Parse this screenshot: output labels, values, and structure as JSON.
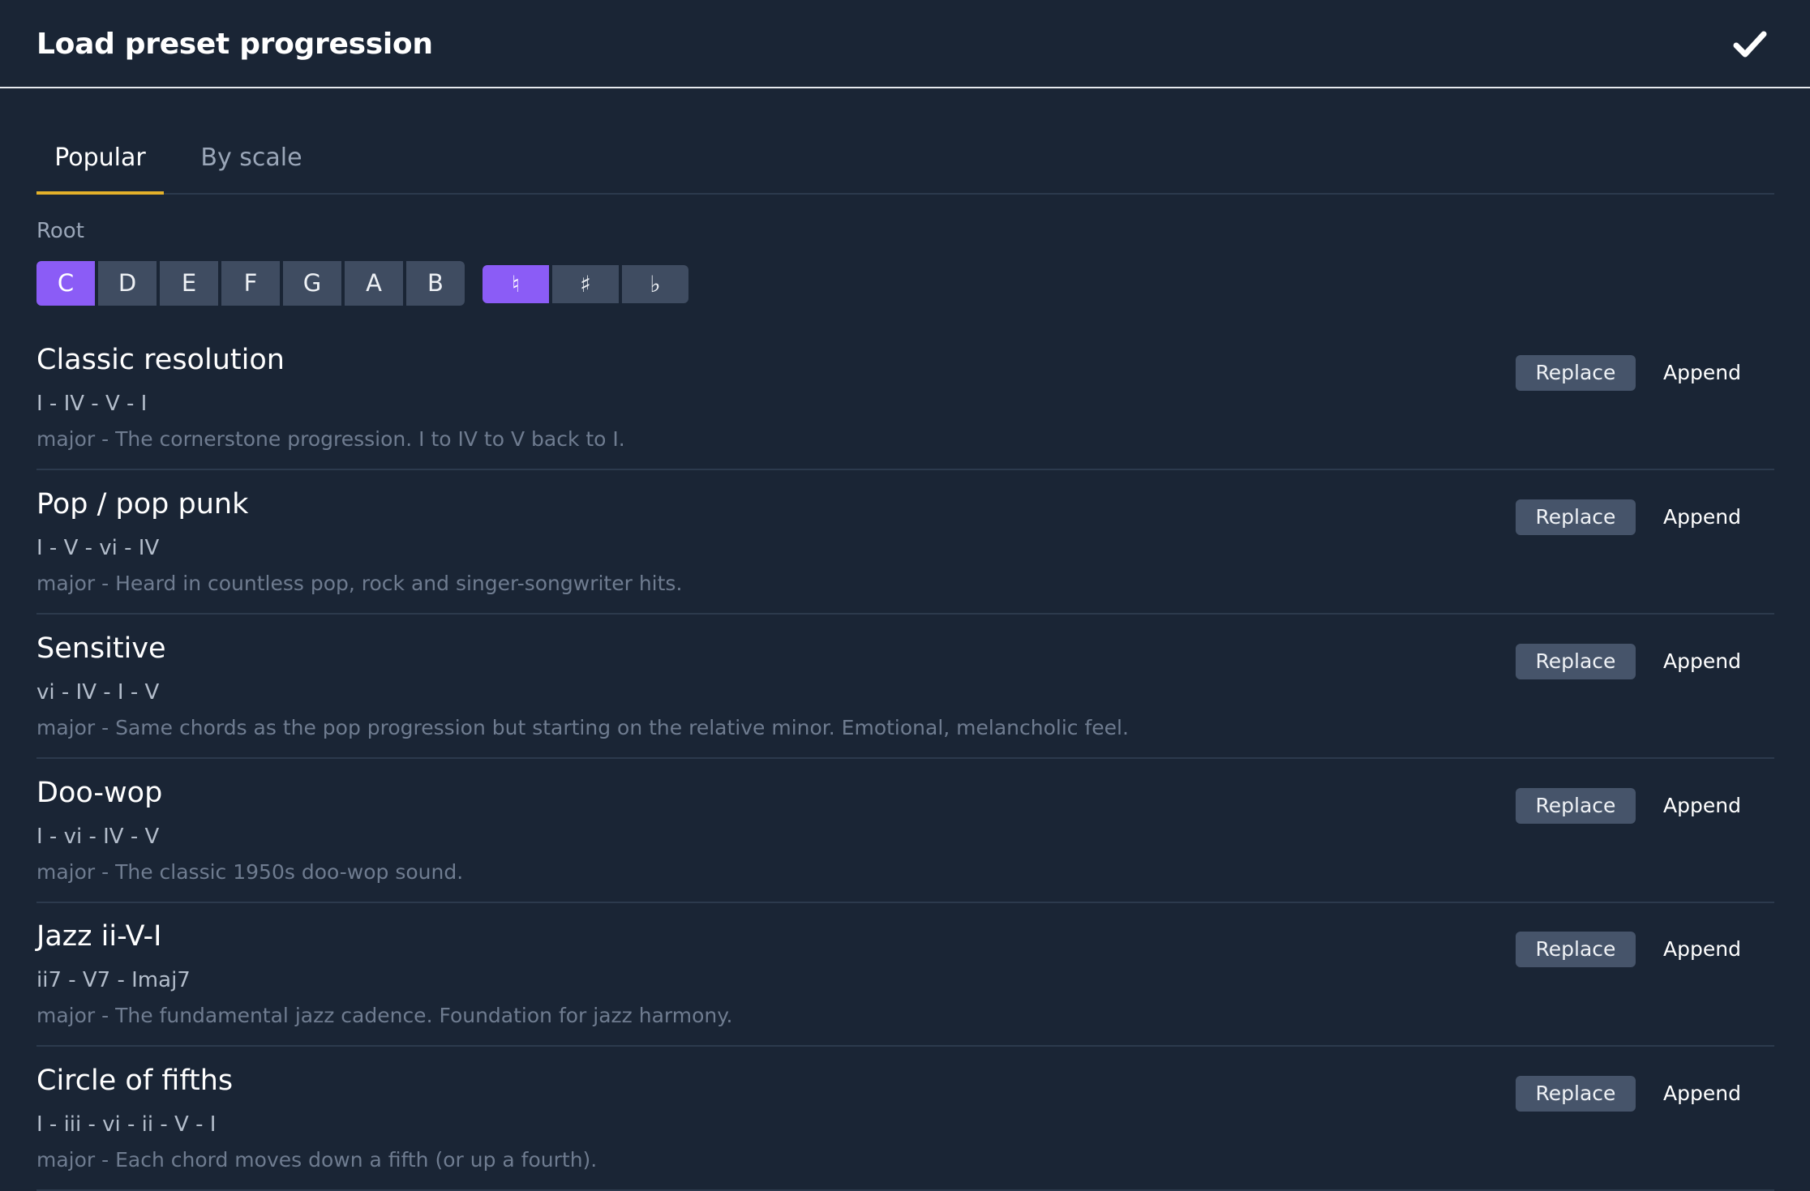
{
  "header": {
    "title": "Load preset progression",
    "confirm_icon": "checkmark-icon"
  },
  "tabs": [
    {
      "label": "Popular",
      "active": true
    },
    {
      "label": "By scale",
      "active": false
    }
  ],
  "root": {
    "label": "Root",
    "notes": [
      "C",
      "D",
      "E",
      "F",
      "G",
      "A",
      "B"
    ],
    "selected_note": "C",
    "accidentals": [
      "♮",
      "♯",
      "♭"
    ],
    "selected_accidental": "♮"
  },
  "presets": [
    {
      "name": "Classic resolution",
      "chords": "I - IV - V - I",
      "description": "major - The cornerstone progression. I to IV to V back to I.",
      "replace_label": "Replace",
      "append_label": "Append"
    },
    {
      "name": "Pop / pop punk",
      "chords": "I - V - vi - IV",
      "description": "major - Heard in countless pop, rock and singer-songwriter hits.",
      "replace_label": "Replace",
      "append_label": "Append"
    },
    {
      "name": "Sensitive",
      "chords": "vi - IV - I - V",
      "description": "major - Same chords as the pop progression but starting on the relative minor. Emotional, melancholic feel.",
      "replace_label": "Replace",
      "append_label": "Append"
    },
    {
      "name": "Doo-wop",
      "chords": "I - vi - IV - V",
      "description": "major - The classic 1950s doo-wop sound.",
      "replace_label": "Replace",
      "append_label": "Append"
    },
    {
      "name": "Jazz ii-V-I",
      "chords": "ii7 - V7 - Imaj7",
      "description": "major - The fundamental jazz cadence. Foundation for jazz harmony.",
      "replace_label": "Replace",
      "append_label": "Append"
    },
    {
      "name": "Circle of fifths",
      "chords": "I - iii - vi - ii - V - I",
      "description": "major - Each chord moves down a fifth (or up a fourth).",
      "replace_label": "Replace",
      "append_label": "Append"
    }
  ],
  "colors": {
    "background": "#1a2535",
    "accent": "#8b5cf6",
    "tab_indicator": "#e4b12a",
    "button": "#46546a"
  }
}
